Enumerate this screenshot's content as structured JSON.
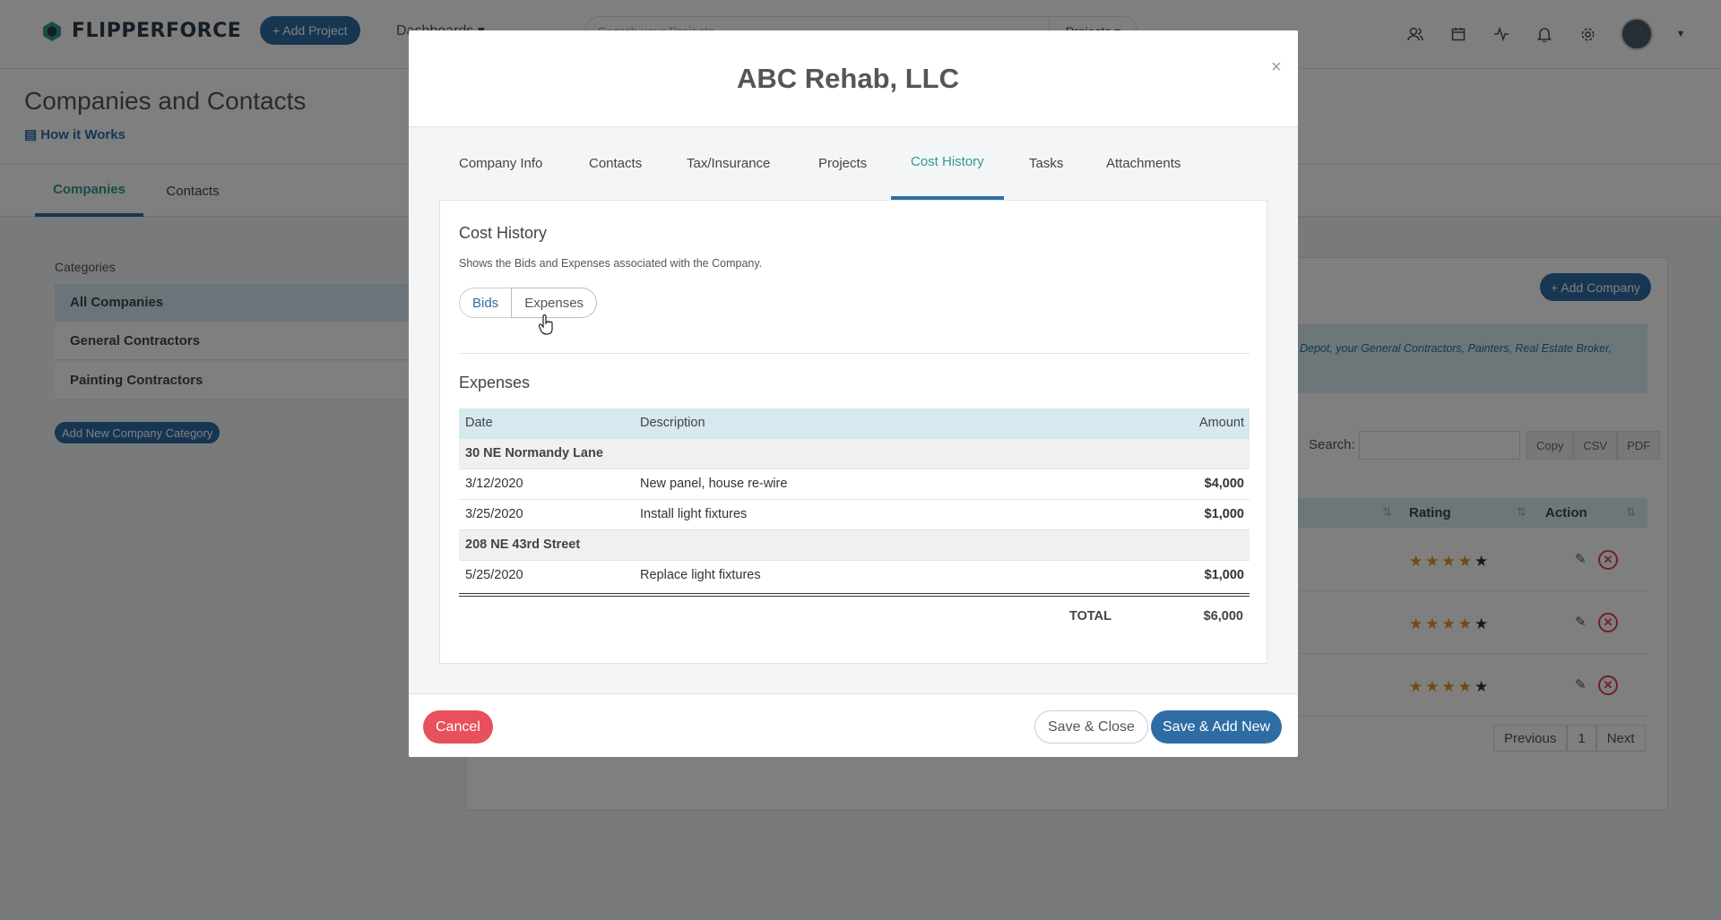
{
  "navbar": {
    "brand": "FLIPPERFORCE",
    "add_project": "+ Add Project",
    "dashboards": "Dashboards ▾",
    "search_placeholder": "Search your Projects",
    "search_scope": "Projects ▾"
  },
  "page": {
    "title": "Companies and Contacts",
    "how_it_works": "How it Works",
    "tabs": [
      "Companies",
      "Contacts"
    ]
  },
  "categories": {
    "heading": "Categories",
    "items": [
      "All Companies",
      "General Contractors",
      "Painting Contractors"
    ],
    "add_button": "Add New Company Category"
  },
  "right_panel": {
    "add_company": "+ Add Company",
    "info_text": "Depot, your General Contractors, Painters, Real Estate Broker,",
    "search_label": "Search:",
    "export_buttons": [
      "Copy",
      "CSV",
      "PDF"
    ],
    "columns": [
      "Rating",
      "Action"
    ],
    "rows": [
      {
        "rating": 4
      },
      {
        "rating": 4
      },
      {
        "rating": 4
      }
    ],
    "pager": [
      "Previous",
      "1",
      "Next"
    ]
  },
  "modal": {
    "title": "ABC Rehab, LLC",
    "close": "×",
    "tabs": [
      "Company Info",
      "Contacts",
      "Tax/Insurance",
      "Projects",
      "Cost History",
      "Tasks",
      "Attachments"
    ],
    "active_tab": "Cost History",
    "card_title": "Cost History",
    "card_subtitle": "Shows the Bids and Expenses associated with the Company.",
    "toggle": {
      "bids": "Bids",
      "expenses": "Expenses"
    },
    "section_title": "Expenses",
    "table": {
      "headers": {
        "date": "Date",
        "description": "Description",
        "amount": "Amount"
      },
      "groups": [
        {
          "name": "30 NE Normandy Lane",
          "rows": [
            {
              "date": "3/12/2020",
              "description": "New panel, house re-wire",
              "amount": "$4,000"
            },
            {
              "date": "3/25/2020",
              "description": "Install light fixtures",
              "amount": "$1,000"
            }
          ]
        },
        {
          "name": "208 NE 43rd Street",
          "rows": [
            {
              "date": "5/25/2020",
              "description": "Replace light fixtures",
              "amount": "$1,000"
            }
          ]
        }
      ],
      "total_label": "TOTAL",
      "total_value": "$6,000"
    },
    "footer": {
      "cancel": "Cancel",
      "save_close": "Save & Close",
      "save_add": "Save & Add New"
    }
  },
  "colors": {
    "primary": "#2e6da4",
    "accent": "#2a9d8f",
    "danger": "#e8505b",
    "star": "#e8932e"
  }
}
